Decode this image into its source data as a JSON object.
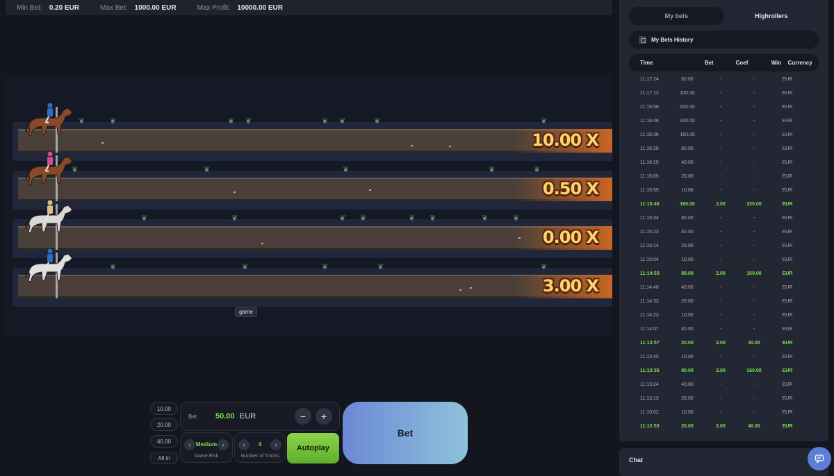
{
  "limits": {
    "min_bet_label": "Min Bet:",
    "min_bet": "0.20 EUR",
    "max_bet_label": "Max Bet:",
    "max_bet": "1000.00 EUR",
    "max_profit_label": "Max Profit:",
    "max_profit": "10000.00 EUR"
  },
  "tracks": [
    {
      "coef": "10.00 X",
      "horse_color": "#8a4a2a",
      "jockey_color": "#2f6fbf"
    },
    {
      "coef": "0.50 X",
      "horse_color": "#8a4a2a",
      "jockey_color": "#d64b8a"
    },
    {
      "coef": "0.00 X",
      "horse_color": "#d8d8d8",
      "jockey_color": "#d9c08a"
    },
    {
      "coef": "3.00 X",
      "horse_color": "#e0e0e0",
      "jockey_color": "#2f6fbf"
    }
  ],
  "tooltip": "game",
  "controls": {
    "quick_bets": [
      "10.00",
      "20.00",
      "40.00",
      "All in"
    ],
    "bet_label": "Bet",
    "bet_amount": "50.00",
    "currency": "EUR",
    "risk_value": "Medium",
    "risk_caption": "Game Risk",
    "tracks_value": "4",
    "tracks_caption": "Number of Tracks",
    "autoplay_label": "Autoplay",
    "bet_button_label": "Bet"
  },
  "panel": {
    "tabs": [
      "My bets",
      "Highrollers"
    ],
    "history_title": "My Bets History",
    "columns": [
      "Time",
      "Bet",
      "Coef",
      "Win",
      "Currency"
    ],
    "rows": [
      [
        "11:17:24",
        "50.00",
        "-",
        "-",
        "EUR",
        false
      ],
      [
        "11:17:13",
        "100.00",
        "-",
        "-",
        "EUR",
        false
      ],
      [
        "11:16:58",
        "320.00",
        "-",
        "-",
        "EUR",
        false
      ],
      [
        "11:16:46",
        "320.00",
        "-",
        "-",
        "EUR",
        false
      ],
      [
        "11:16:36",
        "160.00",
        "-",
        "-",
        "EUR",
        false
      ],
      [
        "11:16:26",
        "80.00",
        "-",
        "-",
        "EUR",
        false
      ],
      [
        "11:16:15",
        "40.00",
        "-",
        "-",
        "EUR",
        false
      ],
      [
        "11:16:05",
        "20.00",
        "-",
        "-",
        "EUR",
        false
      ],
      [
        "11:15:55",
        "10.00",
        "-",
        "-",
        "EUR",
        false
      ],
      [
        "11:15:46",
        "160.00",
        "2.00",
        "320.00",
        "EUR",
        true
      ],
      [
        "11:15:34",
        "80.00",
        "-",
        "-",
        "EUR",
        false
      ],
      [
        "11:15:23",
        "40.00",
        "-",
        "-",
        "EUR",
        false
      ],
      [
        "11:15:14",
        "20.00",
        "-",
        "-",
        "EUR",
        false
      ],
      [
        "11:15:04",
        "10.00",
        "-",
        "-",
        "EUR",
        false
      ],
      [
        "11:14:53",
        "80.00",
        "2.00",
        "160.00",
        "EUR",
        true
      ],
      [
        "11:14:40",
        "40.00",
        "-",
        "-",
        "EUR",
        false
      ],
      [
        "11:14:33",
        "20.00",
        "-",
        "-",
        "EUR",
        false
      ],
      [
        "11:14:23",
        "10.00",
        "-",
        "-",
        "EUR",
        false
      ],
      [
        "11:14:07",
        "40.00",
        "-",
        "-",
        "EUR",
        false
      ],
      [
        "11:13:57",
        "20.00",
        "2.00",
        "40.00",
        "EUR",
        true
      ],
      [
        "11:13:45",
        "10.00",
        "-",
        "-",
        "EUR",
        false
      ],
      [
        "11:13:36",
        "80.00",
        "2.00",
        "160.00",
        "EUR",
        true
      ],
      [
        "11:13:24",
        "40.00",
        "-",
        "-",
        "EUR",
        false
      ],
      [
        "11:13:13",
        "20.00",
        "-",
        "-",
        "EUR",
        false
      ],
      [
        "11:13:02",
        "10.00",
        "-",
        "-",
        "EUR",
        false
      ],
      [
        "11:12:53",
        "20.00",
        "2.00",
        "40.00",
        "EUR",
        true
      ]
    ]
  },
  "chat": {
    "title": "Chat"
  },
  "colors": {
    "accent_green": "#7de04a",
    "bet_gradient_start": "#6c88d6",
    "bet_gradient_end": "#8ec3da"
  }
}
